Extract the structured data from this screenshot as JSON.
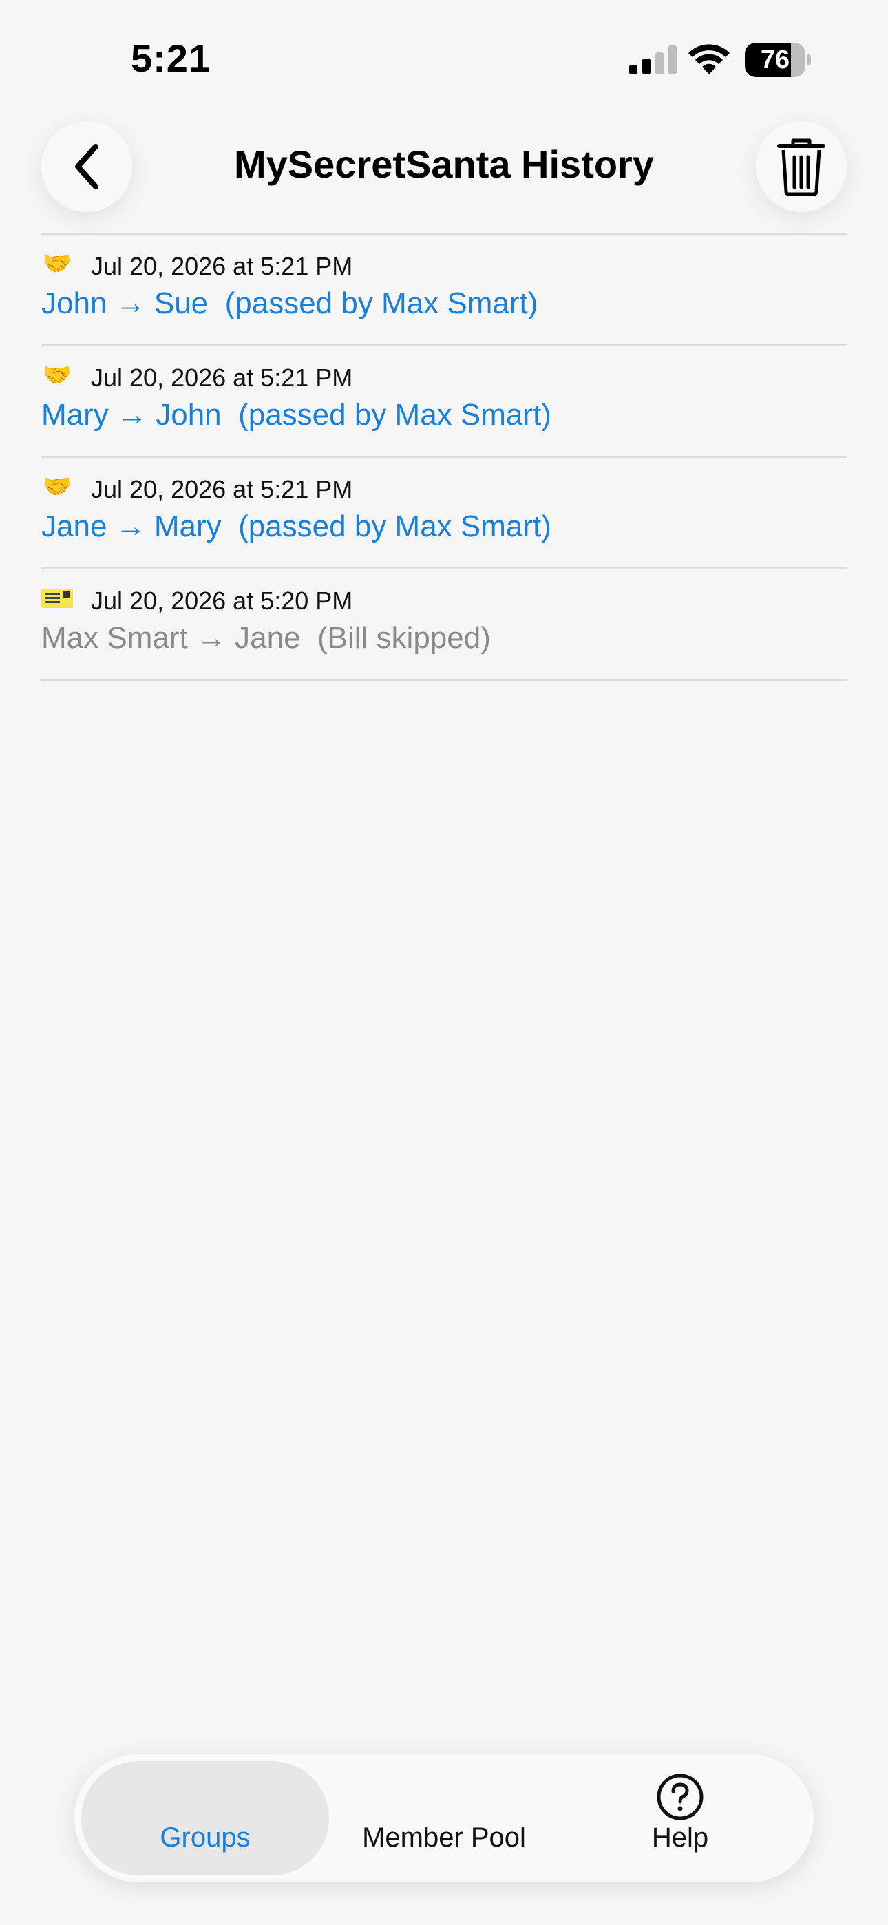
{
  "status_bar": {
    "time": "5:21",
    "battery_level": 76,
    "battery_text": "76"
  },
  "nav": {
    "title": "MySecretSanta History",
    "back_icon": "chevron-left-icon",
    "trash_icon": "trash-icon"
  },
  "history": [
    {
      "icon": "handshake-icon",
      "date": "Jul 20, 2026 at 5:21 PM",
      "text": "John → Sue  (passed by Max Smart)",
      "style": "blue"
    },
    {
      "icon": "handshake-icon",
      "date": "Jul 20, 2026 at 5:21 PM",
      "text": "Mary → John  (passed by Max Smart)",
      "style": "blue"
    },
    {
      "icon": "handshake-icon",
      "date": "Jul 20, 2026 at 5:21 PM",
      "text": "Jane → Mary  (passed by Max Smart)",
      "style": "blue"
    },
    {
      "icon": "ticket-icon",
      "date": "Jul 20, 2026 at 5:20 PM",
      "text": "Max Smart → Jane  (Bill skipped)",
      "style": "gray"
    }
  ],
  "tabs": [
    {
      "label": "Groups",
      "selected": true
    },
    {
      "label": "Member Pool",
      "selected": false
    },
    {
      "label": "Help",
      "selected": false,
      "icon": "help-circle-icon"
    }
  ],
  "colors": {
    "accent": "#1a7fd8",
    "background": "#f5f5f5",
    "muted_text": "#8a8a8a"
  }
}
